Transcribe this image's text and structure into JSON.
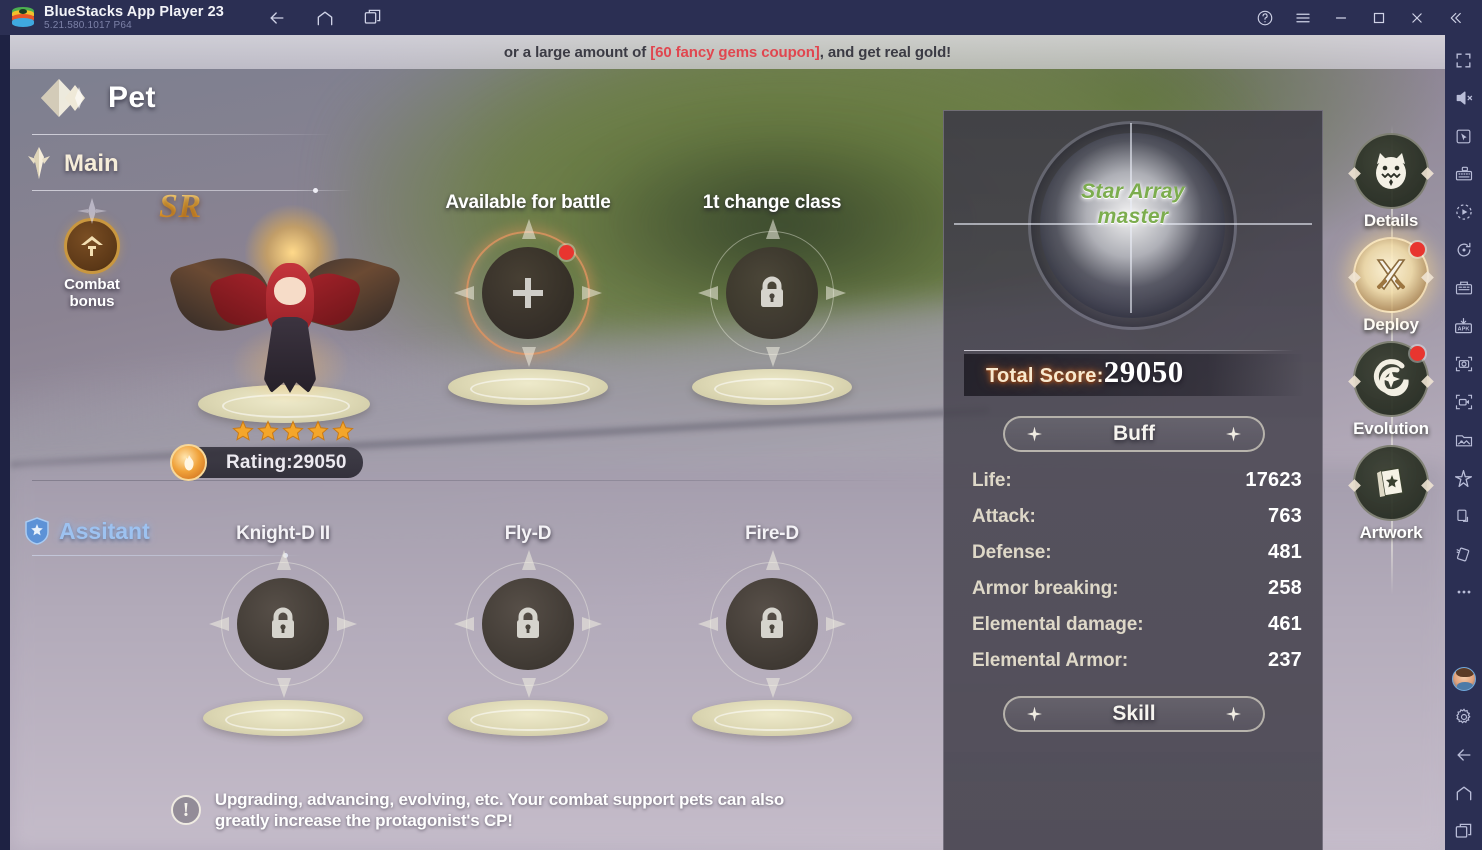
{
  "titlebar": {
    "app_name": "BlueStacks App Player 23",
    "version": "5.21.580.1017  P64",
    "logo_icon": "bluestacks-logo-icon",
    "nav": [
      {
        "name": "back-icon",
        "label": "Back"
      },
      {
        "name": "home-icon",
        "label": "Home"
      },
      {
        "name": "recents-icon",
        "label": "Recent apps"
      }
    ],
    "controls": [
      {
        "name": "help-icon",
        "label": "Help"
      },
      {
        "name": "menu-icon",
        "label": "Menu"
      },
      {
        "name": "minimize-icon",
        "label": "Minimize"
      },
      {
        "name": "maximize-icon",
        "label": "Maximize"
      },
      {
        "name": "close-icon",
        "label": "Close"
      },
      {
        "name": "collapse-icon",
        "label": "Collapse"
      }
    ]
  },
  "sidebar": {
    "items": [
      {
        "name": "fullscreen-icon",
        "label": "Fullscreen"
      },
      {
        "name": "mute-icon",
        "label": "Mute"
      },
      {
        "name": "cursor-icon",
        "label": "Cursor"
      },
      {
        "name": "keyboard-controls-icon",
        "label": "Game controls"
      },
      {
        "name": "macro-play-icon",
        "label": "Macro"
      },
      {
        "name": "rotate-icon",
        "label": "Rotate"
      },
      {
        "name": "multi-instance-icon",
        "label": "Multi-instance"
      },
      {
        "name": "install-apk-icon",
        "label": "Install APK"
      },
      {
        "name": "screenshot-icon",
        "label": "Screenshot"
      },
      {
        "name": "record-icon",
        "label": "Record screen"
      },
      {
        "name": "media-manager-icon",
        "label": "Media manager"
      },
      {
        "name": "eco-mode-icon",
        "label": "Eco mode"
      },
      {
        "name": "shake-icon",
        "label": "Shake"
      },
      {
        "name": "tilt-icon",
        "label": "Tilt"
      },
      {
        "name": "more-options-icon",
        "label": "More"
      }
    ],
    "bottom_items": [
      {
        "name": "user-avatar",
        "label": "Account"
      },
      {
        "name": "settings-gear-icon",
        "label": "Settings"
      },
      {
        "name": "android-back-icon",
        "label": "Back"
      },
      {
        "name": "android-home-icon",
        "label": "Home"
      },
      {
        "name": "android-recents-icon",
        "label": "Recents"
      }
    ]
  },
  "banner": {
    "prefix": "or a large amount of ",
    "highlight": "[60 fancy gems coupon]",
    "suffix": ", and get real gold!",
    "highlight_color": "#e0464f"
  },
  "header": {
    "title": "Pet",
    "back_icon": "back-diamond-icon",
    "tab": {
      "label": "Main",
      "icon": "main-tab-icon"
    }
  },
  "character": {
    "rarity": "SR",
    "combat_bonus_label": "Combat bonus",
    "combat_bonus_icon": "combat-bonus-icon",
    "stars": 5,
    "rating_label": "Rating:29050",
    "rating_icon": "flame-icon"
  },
  "pet_slots": [
    {
      "title": "Available for battle",
      "state": "empty",
      "icon": "plus-icon",
      "badge": true
    },
    {
      "title": "1t change class",
      "state": "locked",
      "icon": "lock-icon",
      "badge": false
    }
  ],
  "assistant": {
    "label": "Assitant",
    "icon": "shield-icon",
    "slots": [
      {
        "title": "Knight-D II",
        "state": "locked",
        "icon": "lock-icon"
      },
      {
        "title": "Fly-D",
        "state": "locked",
        "icon": "lock-icon"
      },
      {
        "title": "Fire-D",
        "state": "locked",
        "icon": "lock-icon"
      }
    ]
  },
  "stat_panel": {
    "orb_title_line1": "Star Array",
    "orb_title_line2": "master",
    "orb_title_color": "#7cad4e",
    "score_label": "Total Score:",
    "score_value": "29050",
    "buff_button": "Buff",
    "skill_button": "Skill",
    "stats": [
      {
        "label": "Life:",
        "value": "17623"
      },
      {
        "label": "Attack:",
        "value": "763"
      },
      {
        "label": "Defense:",
        "value": "481"
      },
      {
        "label": "Armor breaking:",
        "value": "258"
      },
      {
        "label": "Elemental damage:",
        "value": "461"
      },
      {
        "label": "Elemental Armor:",
        "value": "237"
      }
    ]
  },
  "game_rail": [
    {
      "label": "Details",
      "icon": "pet-face-icon",
      "badge": false,
      "glow": false
    },
    {
      "label": "Deploy",
      "icon": "crossed-swords-icon",
      "badge": true,
      "glow": true
    },
    {
      "label": "Evolution",
      "icon": "evolution-swirl-icon",
      "badge": true,
      "glow": false
    },
    {
      "label": "Artwork",
      "icon": "artwork-book-icon",
      "badge": false,
      "glow": false
    }
  ],
  "tip": {
    "icon": "exclamation-icon",
    "line1": "Upgrading, advancing, evolving, etc. Your combat support pets can also",
    "line2": "greatly increase the protagonist's CP!"
  }
}
